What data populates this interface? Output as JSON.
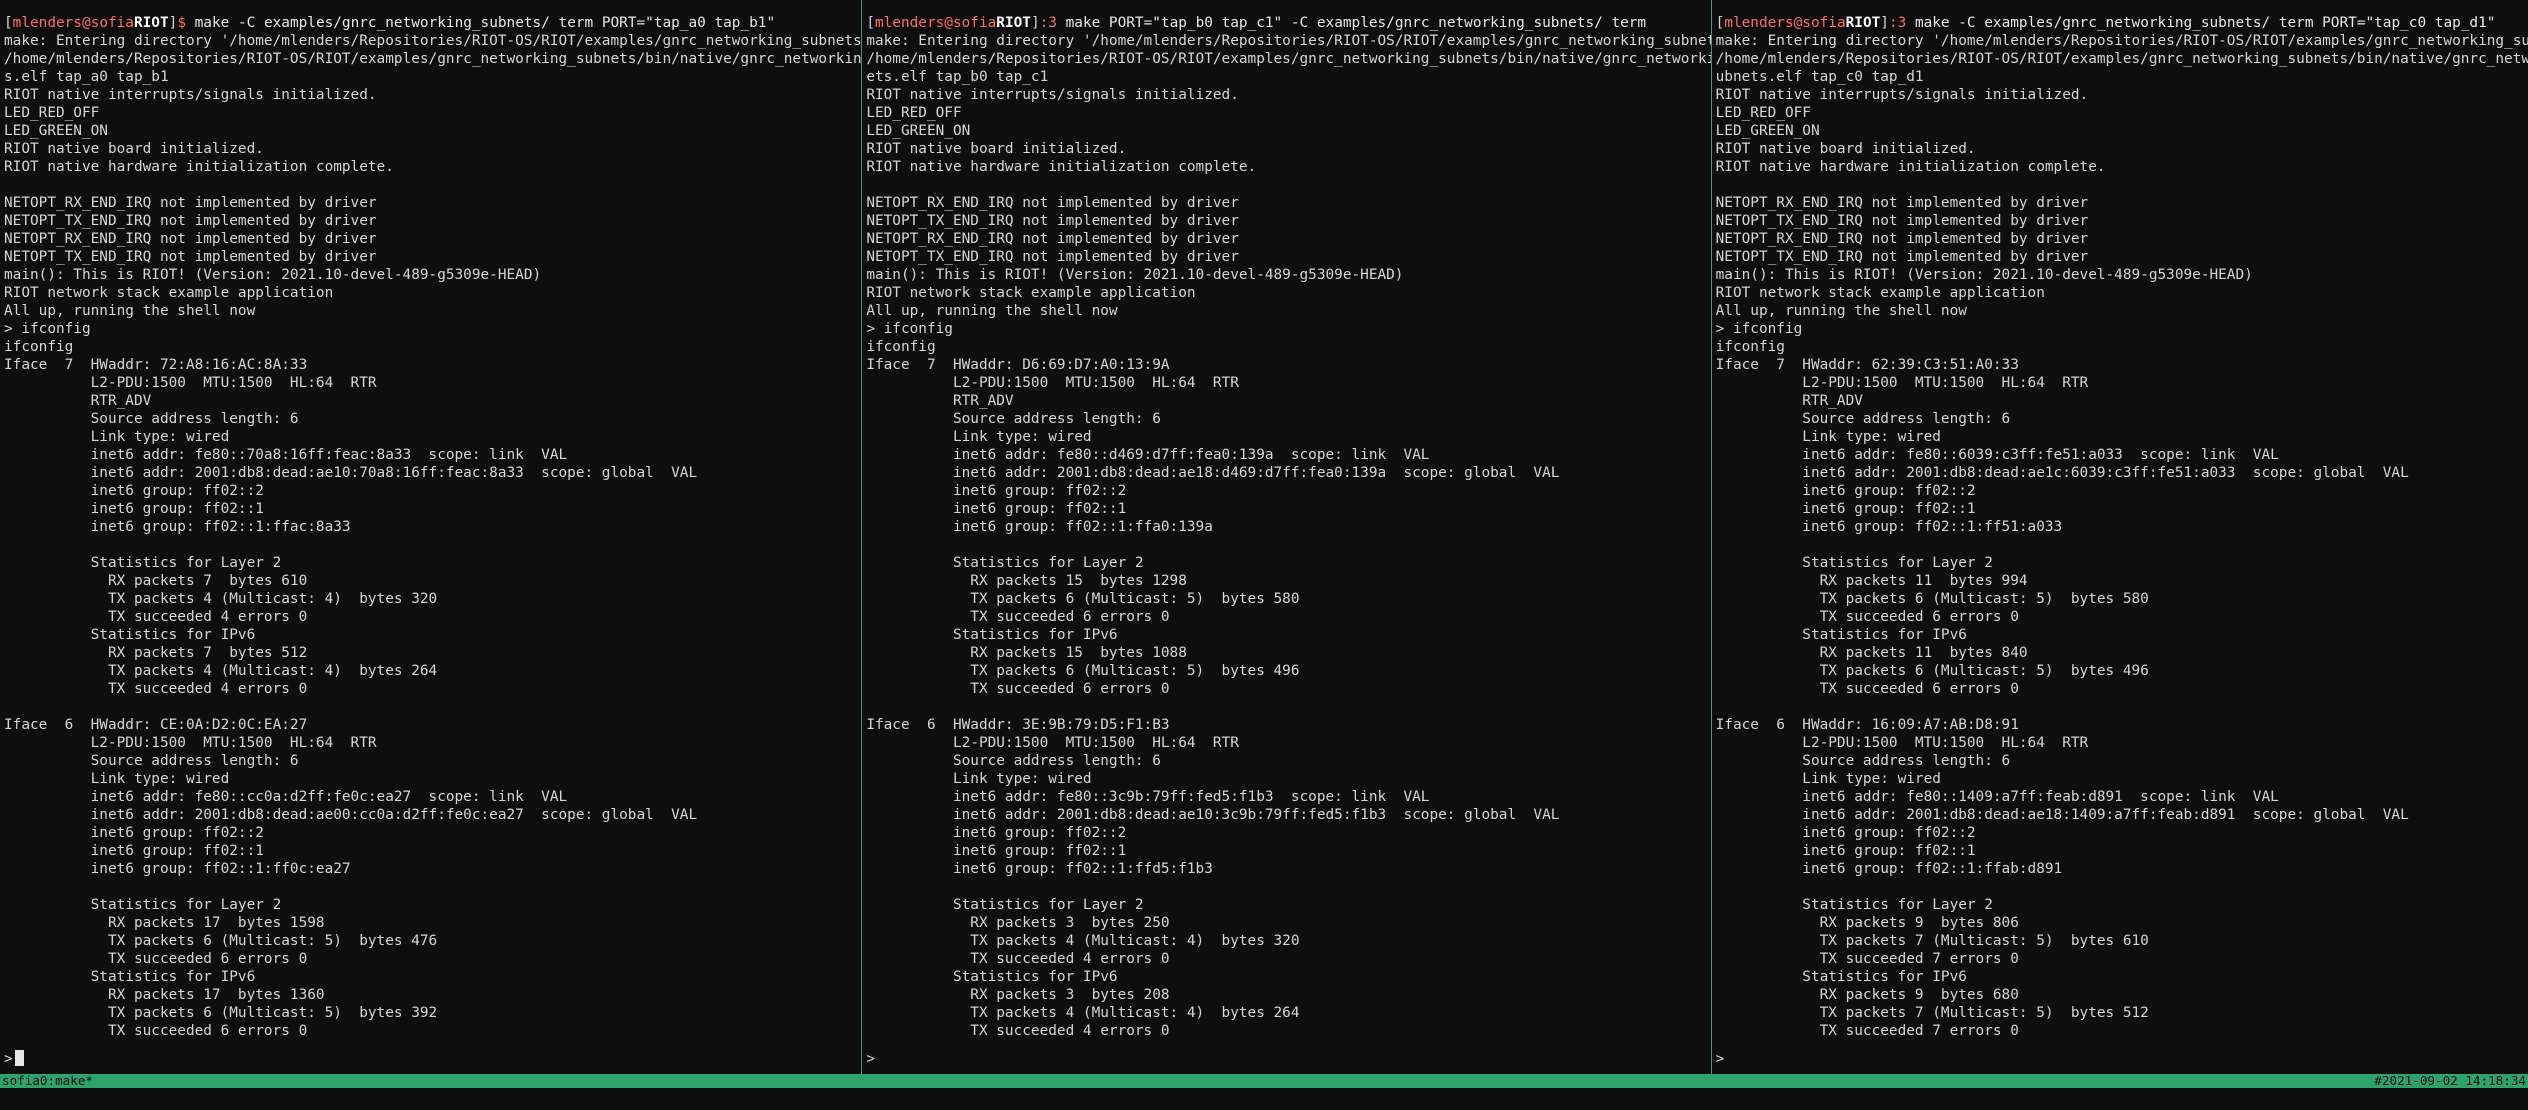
{
  "colors": {
    "background": "#0e0e0e",
    "foreground": "#d6d6d6",
    "accent": "#2ea36c",
    "prompt_user": "#ff6b6b"
  },
  "panes": [
    {
      "prompt": {
        "open": "[",
        "user": "mlenders",
        "at": "@",
        "host_plain": "sofia",
        "host_bold": "RIOT",
        "close": "]",
        "symbol": "$",
        "command": " make -C examples/gnrc_networking_subnets/ term PORT=\"tap_a0 tap_b1\""
      },
      "lines": [
        "make: Entering directory '/home/mlenders/Repositories/RIOT-OS/RIOT/examples/gnrc_networking_subnets'",
        "/home/mlenders/Repositories/RIOT-OS/RIOT/examples/gnrc_networking_subnets/bin/native/gnrc_networking-subnet",
        "s.elf tap_a0 tap_b1",
        "RIOT native interrupts/signals initialized.",
        "LED_RED_OFF",
        "LED_GREEN_ON",
        "RIOT native board initialized.",
        "RIOT native hardware initialization complete.",
        "",
        "NETOPT_RX_END_IRQ not implemented by driver",
        "NETOPT_TX_END_IRQ not implemented by driver",
        "NETOPT_RX_END_IRQ not implemented by driver",
        "NETOPT_TX_END_IRQ not implemented by driver",
        "main(): This is RIOT! (Version: 2021.10-devel-489-g5309e-HEAD)",
        "RIOT network stack example application",
        "All up, running the shell now",
        "> ifconfig",
        "ifconfig",
        "Iface  7  HWaddr: 72:A8:16:AC:8A:33",
        "          L2-PDU:1500  MTU:1500  HL:64  RTR",
        "          RTR_ADV",
        "          Source address length: 6",
        "          Link type: wired",
        "          inet6 addr: fe80::70a8:16ff:feac:8a33  scope: link  VAL",
        "          inet6 addr: 2001:db8:dead:ae10:70a8:16ff:feac:8a33  scope: global  VAL",
        "          inet6 group: ff02::2",
        "          inet6 group: ff02::1",
        "          inet6 group: ff02::1:ffac:8a33",
        "",
        "          Statistics for Layer 2",
        "            RX packets 7  bytes 610",
        "            TX packets 4 (Multicast: 4)  bytes 320",
        "            TX succeeded 4 errors 0",
        "          Statistics for IPv6",
        "            RX packets 7  bytes 512",
        "            TX packets 4 (Multicast: 4)  bytes 264",
        "            TX succeeded 4 errors 0",
        "",
        "Iface  6  HWaddr: CE:0A:D2:0C:EA:27",
        "          L2-PDU:1500  MTU:1500  HL:64  RTR",
        "          Source address length: 6",
        "          Link type: wired",
        "          inet6 addr: fe80::cc0a:d2ff:fe0c:ea27  scope: link  VAL",
        "          inet6 addr: 2001:db8:dead:ae00:cc0a:d2ff:fe0c:ea27  scope: global  VAL",
        "          inet6 group: ff02::2",
        "          inet6 group: ff02::1",
        "          inet6 group: ff02::1:ff0c:ea27",
        "",
        "          Statistics for Layer 2",
        "            RX packets 17  bytes 1598",
        "            TX packets 6 (Multicast: 5)  bytes 476",
        "            TX succeeded 6 errors 0",
        "          Statistics for IPv6",
        "            RX packets 17  bytes 1360",
        "            TX packets 6 (Multicast: 5)  bytes 392",
        "            TX succeeded 6 errors 0"
      ],
      "shell_prompt": ">"
    },
    {
      "prompt": {
        "open": "[",
        "user": "mlenders",
        "at": "@",
        "host_plain": "sofia",
        "host_bold": "RIOT",
        "close": "]",
        "symbol": ":3",
        "command": " make PORT=\"tap_b0 tap_c1\" -C examples/gnrc_networking_subnets/ term"
      },
      "lines": [
        "make: Entering directory '/home/mlenders/Repositories/RIOT-OS/RIOT/examples/gnrc_networking_subnets'",
        "/home/mlenders/Repositories/RIOT-OS/RIOT/examples/gnrc_networking_subnets/bin/native/gnrc_networking-subn",
        "ets.elf tap_b0 tap_c1",
        "RIOT native interrupts/signals initialized.",
        "LED_RED_OFF",
        "LED_GREEN_ON",
        "RIOT native board initialized.",
        "RIOT native hardware initialization complete.",
        "",
        "NETOPT_RX_END_IRQ not implemented by driver",
        "NETOPT_TX_END_IRQ not implemented by driver",
        "NETOPT_RX_END_IRQ not implemented by driver",
        "NETOPT_TX_END_IRQ not implemented by driver",
        "main(): This is RIOT! (Version: 2021.10-devel-489-g5309e-HEAD)",
        "RIOT network stack example application",
        "All up, running the shell now",
        "> ifconfig",
        "ifconfig",
        "Iface  7  HWaddr: D6:69:D7:A0:13:9A",
        "          L2-PDU:1500  MTU:1500  HL:64  RTR",
        "          RTR_ADV",
        "          Source address length: 6",
        "          Link type: wired",
        "          inet6 addr: fe80::d469:d7ff:fea0:139a  scope: link  VAL",
        "          inet6 addr: 2001:db8:dead:ae18:d469:d7ff:fea0:139a  scope: global  VAL",
        "          inet6 group: ff02::2",
        "          inet6 group: ff02::1",
        "          inet6 group: ff02::1:ffa0:139a",
        "",
        "          Statistics for Layer 2",
        "            RX packets 15  bytes 1298",
        "            TX packets 6 (Multicast: 5)  bytes 580",
        "            TX succeeded 6 errors 0",
        "          Statistics for IPv6",
        "            RX packets 15  bytes 1088",
        "            TX packets 6 (Multicast: 5)  bytes 496",
        "            TX succeeded 6 errors 0",
        "",
        "Iface  6  HWaddr: 3E:9B:79:D5:F1:B3",
        "          L2-PDU:1500  MTU:1500  HL:64  RTR",
        "          Source address length: 6",
        "          Link type: wired",
        "          inet6 addr: fe80::3c9b:79ff:fed5:f1b3  scope: link  VAL",
        "          inet6 addr: 2001:db8:dead:ae10:3c9b:79ff:fed5:f1b3  scope: global  VAL",
        "          inet6 group: ff02::2",
        "          inet6 group: ff02::1",
        "          inet6 group: ff02::1:ffd5:f1b3",
        "",
        "          Statistics for Layer 2",
        "            RX packets 3  bytes 250",
        "            TX packets 4 (Multicast: 4)  bytes 320",
        "            TX succeeded 4 errors 0",
        "          Statistics for IPv6",
        "            RX packets 3  bytes 208",
        "            TX packets 4 (Multicast: 4)  bytes 264",
        "            TX succeeded 4 errors 0"
      ],
      "shell_prompt": ">"
    },
    {
      "prompt": {
        "open": "[",
        "user": "mlenders",
        "at": "@",
        "host_plain": "sofia",
        "host_bold": "RIOT",
        "close": "]",
        "symbol": ":3",
        "command": " make -C examples/gnrc_networking_subnets/ term PORT=\"tap_c0 tap_d1\""
      },
      "lines": [
        "make: Entering directory '/home/mlenders/Repositories/RIOT-OS/RIOT/examples/gnrc_networking_subnets'",
        "/home/mlenders/Repositories/RIOT-OS/RIOT/examples/gnrc_networking_subnets/bin/native/gnrc_networking-s",
        "ubnets.elf tap_c0 tap_d1",
        "RIOT native interrupts/signals initialized.",
        "LED_RED_OFF",
        "LED_GREEN_ON",
        "RIOT native board initialized.",
        "RIOT native hardware initialization complete.",
        "",
        "NETOPT_RX_END_IRQ not implemented by driver",
        "NETOPT_TX_END_IRQ not implemented by driver",
        "NETOPT_RX_END_IRQ not implemented by driver",
        "NETOPT_TX_END_IRQ not implemented by driver",
        "main(): This is RIOT! (Version: 2021.10-devel-489-g5309e-HEAD)",
        "RIOT network stack example application",
        "All up, running the shell now",
        "> ifconfig",
        "ifconfig",
        "Iface  7  HWaddr: 62:39:C3:51:A0:33",
        "          L2-PDU:1500  MTU:1500  HL:64  RTR",
        "          RTR_ADV",
        "          Source address length: 6",
        "          Link type: wired",
        "          inet6 addr: fe80::6039:c3ff:fe51:a033  scope: link  VAL",
        "          inet6 addr: 2001:db8:dead:ae1c:6039:c3ff:fe51:a033  scope: global  VAL",
        "          inet6 group: ff02::2",
        "          inet6 group: ff02::1",
        "          inet6 group: ff02::1:ff51:a033",
        "",
        "          Statistics for Layer 2",
        "            RX packets 11  bytes 994",
        "            TX packets 6 (Multicast: 5)  bytes 580",
        "            TX succeeded 6 errors 0",
        "          Statistics for IPv6",
        "            RX packets 11  bytes 840",
        "            TX packets 6 (Multicast: 5)  bytes 496",
        "            TX succeeded 6 errors 0",
        "",
        "Iface  6  HWaddr: 16:09:A7:AB:D8:91",
        "          L2-PDU:1500  MTU:1500  HL:64  RTR",
        "          Source address length: 6",
        "          Link type: wired",
        "          inet6 addr: fe80::1409:a7ff:feab:d891  scope: link  VAL",
        "          inet6 addr: 2001:db8:dead:ae18:1409:a7ff:feab:d891  scope: global  VAL",
        "          inet6 group: ff02::2",
        "          inet6 group: ff02::1",
        "          inet6 group: ff02::1:ffab:d891",
        "",
        "          Statistics for Layer 2",
        "            RX packets 9  bytes 806",
        "            TX packets 7 (Multicast: 5)  bytes 610",
        "            TX succeeded 7 errors 0",
        "          Statistics for IPv6",
        "            RX packets 9  bytes 680",
        "            TX packets 7 (Multicast: 5)  bytes 512",
        "            TX succeeded 7 errors 0"
      ],
      "shell_prompt": ">"
    }
  ],
  "statusbar": {
    "left": "sofia0:make*",
    "right": "#2021-09-02 14:18:34"
  }
}
